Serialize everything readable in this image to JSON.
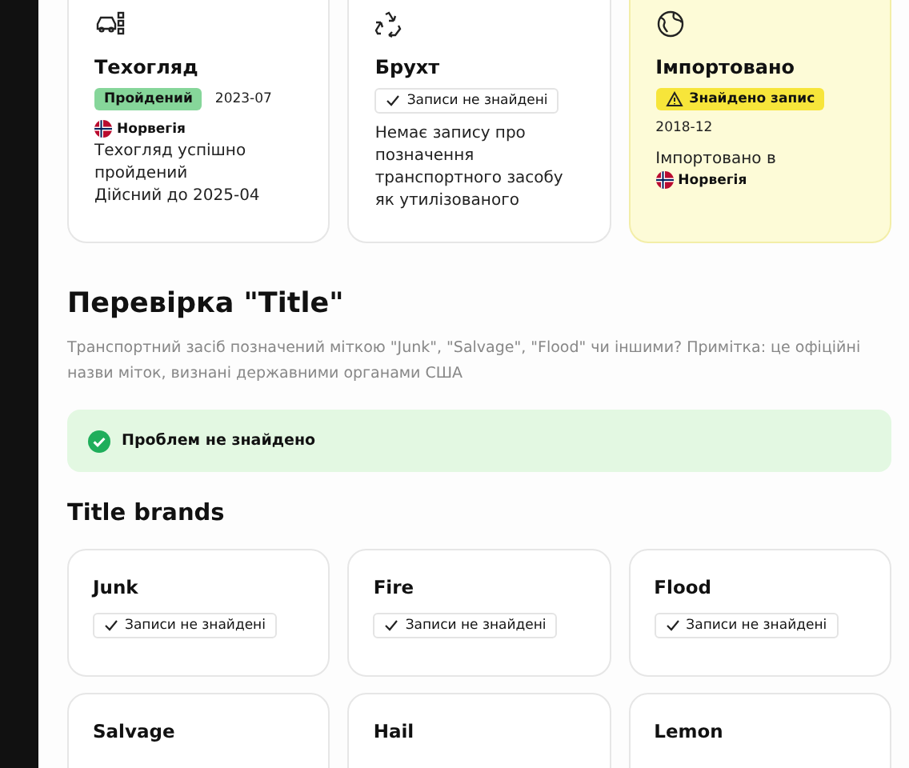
{
  "summary_cards": [
    {
      "kind": "inspection",
      "title": "Техогляд",
      "highlighted": false,
      "status": {
        "kind": "passed",
        "text": "Пройдений"
      },
      "date": "2023-07",
      "country": "Норвегія",
      "lines": [
        "Техогляд успішно пройдений",
        "Дійсний до 2025-04"
      ]
    },
    {
      "kind": "recycle",
      "title": "Брухт",
      "highlighted": false,
      "status": {
        "kind": "none",
        "text": "Записи не знайдені"
      },
      "lines": [
        "Немає запису про позначення транспортного засобу як утилізованого"
      ]
    },
    {
      "kind": "globe",
      "title": "Імпортовано",
      "highlighted": true,
      "status": {
        "kind": "found",
        "text": "Знайдено запис"
      },
      "date_below": "2018-12",
      "lines": [
        "Імпортовано в"
      ],
      "country_after": "Норвегія"
    }
  ],
  "title_check": {
    "heading": "Перевірка \"Title\"",
    "description": "Транспортний засіб позначений міткою \"Junk\", \"Salvage\", \"Flood\" чи іншими? Примітка: це офіційні назви міток, визнані державними органами США",
    "alert": {
      "kind": "success",
      "text": "Проблем не знайдено"
    }
  },
  "brands": {
    "heading": "Title brands",
    "items": [
      {
        "name": "Junk",
        "status": {
          "kind": "none",
          "text": "Записи не знайдені"
        }
      },
      {
        "name": "Fire",
        "status": {
          "kind": "none",
          "text": "Записи не знайдені"
        }
      },
      {
        "name": "Flood",
        "status": {
          "kind": "none",
          "text": "Записи не знайдені"
        }
      },
      {
        "name": "Salvage"
      },
      {
        "name": "Hail"
      },
      {
        "name": "Lemon"
      }
    ]
  }
}
